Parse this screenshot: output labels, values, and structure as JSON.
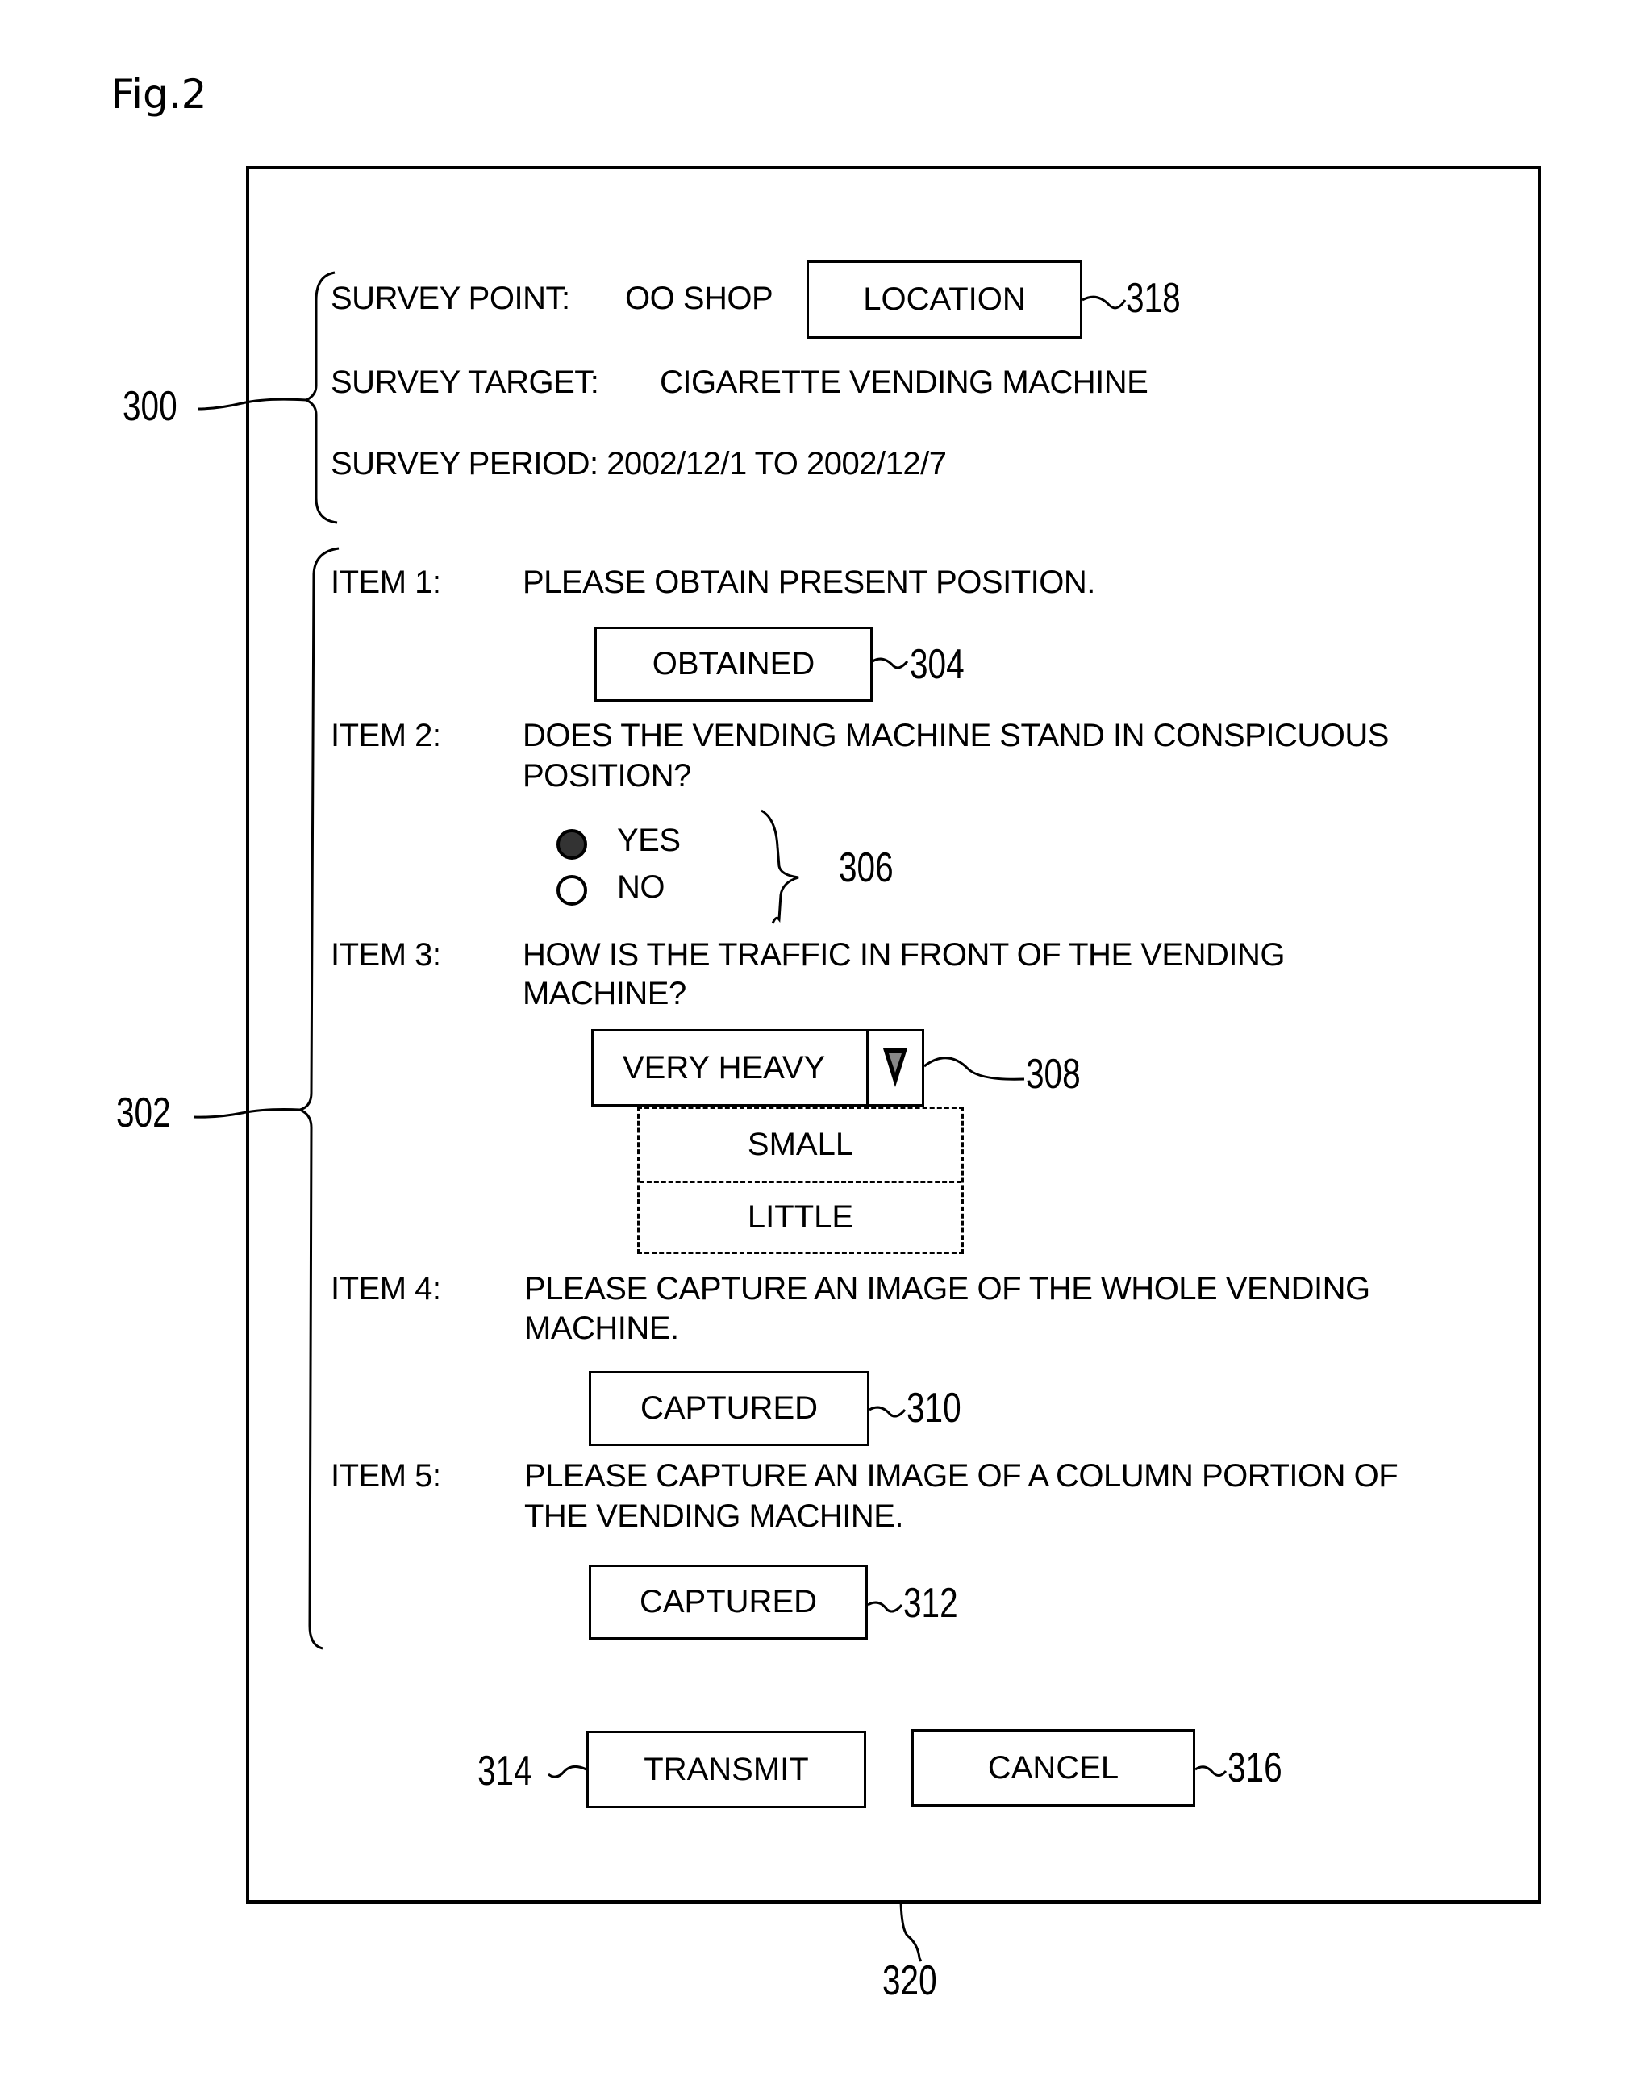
{
  "figure_label": "Fig.2",
  "header": {
    "survey_point_label": "SURVEY POINT:",
    "survey_point_value": "OO SHOP",
    "location_button": "LOCATION",
    "survey_target_label": "SURVEY TARGET:",
    "survey_target_value": "CIGARETTE VENDING MACHINE",
    "survey_period": "SURVEY PERIOD: 2002/12/1 TO 2002/12/7"
  },
  "items": [
    {
      "label": "ITEM 1:",
      "lines": [
        "PLEASE OBTAIN PRESENT POSITION."
      ],
      "button": "OBTAINED"
    },
    {
      "label": "ITEM 2:",
      "lines": [
        "DOES THE VENDING MACHINE STAND IN CONSPICUOUS",
        "POSITION?"
      ],
      "options": [
        {
          "label": "YES",
          "selected": true
        },
        {
          "label": "NO",
          "selected": false
        }
      ]
    },
    {
      "label": "ITEM 3:",
      "lines": [
        "HOW IS THE TRAFFIC IN FRONT OF THE VENDING",
        "MACHINE?"
      ],
      "selected": "VERY HEAVY",
      "dropdown_options": [
        "SMALL",
        "LITTLE"
      ]
    },
    {
      "label": "ITEM 4:",
      "lines": [
        "PLEASE CAPTURE AN IMAGE OF THE WHOLE VENDING",
        "MACHINE."
      ],
      "button": "CAPTURED"
    },
    {
      "label": "ITEM 5:",
      "lines": [
        "PLEASE CAPTURE AN IMAGE OF A COLUMN PORTION OF",
        "THE VENDING MACHINE."
      ],
      "button": "CAPTURED"
    }
  ],
  "actions": {
    "transmit": "TRANSMIT",
    "cancel": "CANCEL"
  },
  "refs": {
    "header_group": "300",
    "items_group": "302",
    "obtained": "304",
    "radio_group": "306",
    "dropdown": "308",
    "captured_1": "310",
    "captured_2": "312",
    "transmit": "314",
    "cancel": "316",
    "location": "318",
    "screen": "320"
  }
}
